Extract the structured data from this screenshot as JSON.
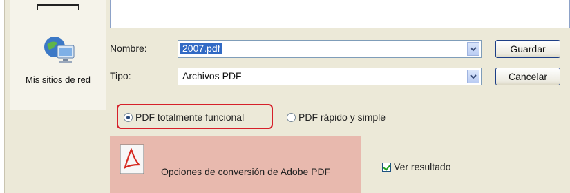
{
  "places": {
    "network_label": "Mis sitios de red"
  },
  "fields": {
    "name_label": "Nombre:",
    "name_value": "2007.pdf",
    "type_label": "Tipo:",
    "type_value": "Archivos PDF"
  },
  "buttons": {
    "save": "Guardar",
    "cancel": "Cancelar"
  },
  "options": {
    "radio_full": "PDF totalmente funcional",
    "radio_full_selected": true,
    "radio_fast": "PDF rápido y simple",
    "conversion_options": "Opciones de conversión de Adobe PDF",
    "view_result": "Ver resultado",
    "view_result_checked": true
  },
  "colors": {
    "highlight": "#d6202a",
    "selection": "#316ac5",
    "panel": "#e8b9ae"
  }
}
